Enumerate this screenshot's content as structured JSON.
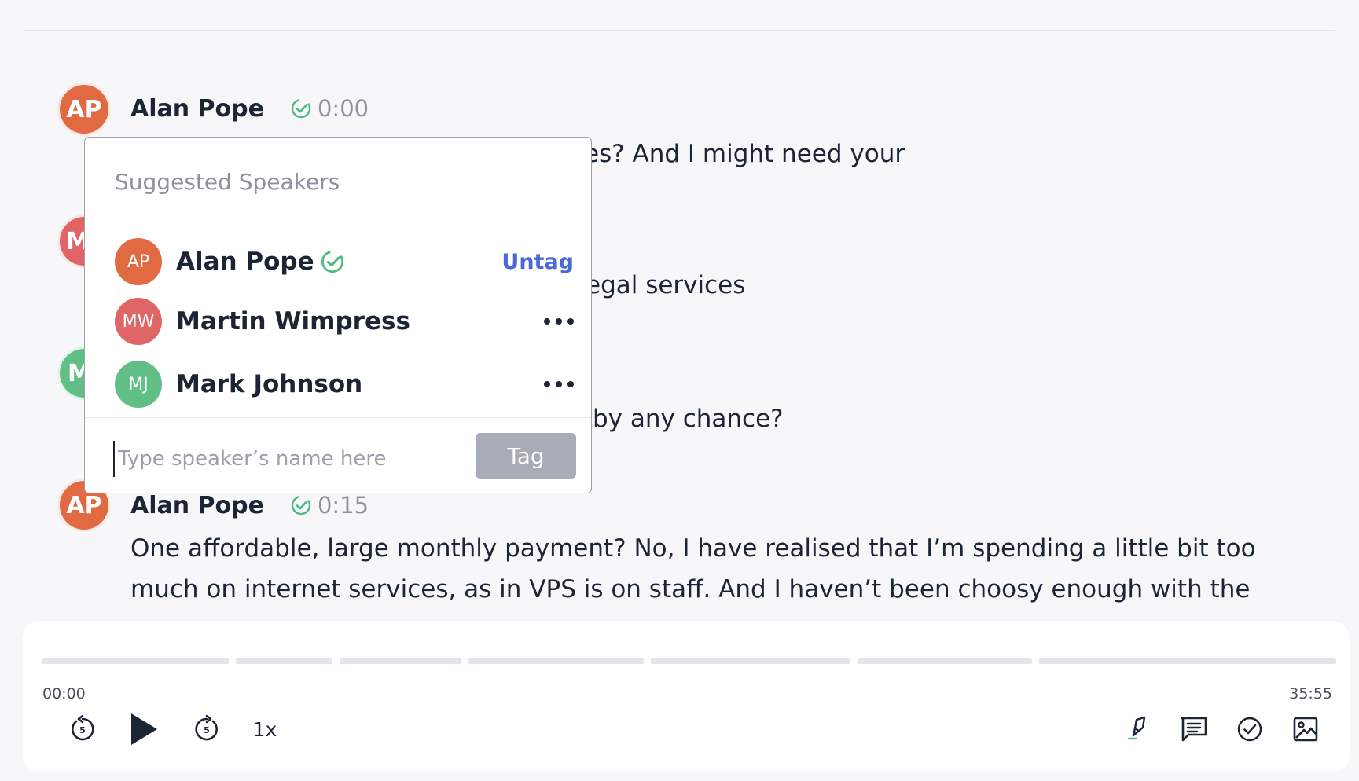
{
  "transcript": {
    "entries": [
      {
        "initials": "AP",
        "color": "#e26a43",
        "speaker": "Alan Pope",
        "timestamp": "0:00",
        "lines": [
          "es? And I might need your"
        ]
      },
      {
        "initials": "MV",
        "color": "#e06567",
        "lines": [
          "egal services"
        ]
      },
      {
        "initials": "M",
        "color": "#61bf85",
        "lines": [
          "by any chance?"
        ]
      },
      {
        "initials": "AP",
        "color": "#e26a43",
        "speaker": "Alan Pope",
        "timestamp": "0:15",
        "lines": [
          "One affordable, large monthly payment? No, I have realised that I’m spending a little bit too",
          "much on internet services, as in VPS is on staff. And I haven’t been choosy enough with the"
        ]
      }
    ]
  },
  "popover": {
    "heading": "Suggested Speakers",
    "speakers": [
      {
        "initials": "AP",
        "name": "Alan Pope",
        "color": "#e26a43",
        "tagged": true,
        "action": "Untag"
      },
      {
        "initials": "MW",
        "name": "Martin Wimpress",
        "color": "#e06567",
        "tagged": false
      },
      {
        "initials": "MJ",
        "name": "Mark Johnson",
        "color": "#61bf85",
        "tagged": false
      }
    ],
    "input_placeholder": "Type speaker’s name here",
    "tag_label": "Tag"
  },
  "player": {
    "current_time": "00:00",
    "total_time": "35:55",
    "progress": 0,
    "speed": "1x",
    "icons": [
      "rewind-5-icon",
      "play-icon",
      "forward-5-icon",
      "highlight-icon",
      "comment-icon",
      "check-circle-icon",
      "image-icon"
    ]
  }
}
